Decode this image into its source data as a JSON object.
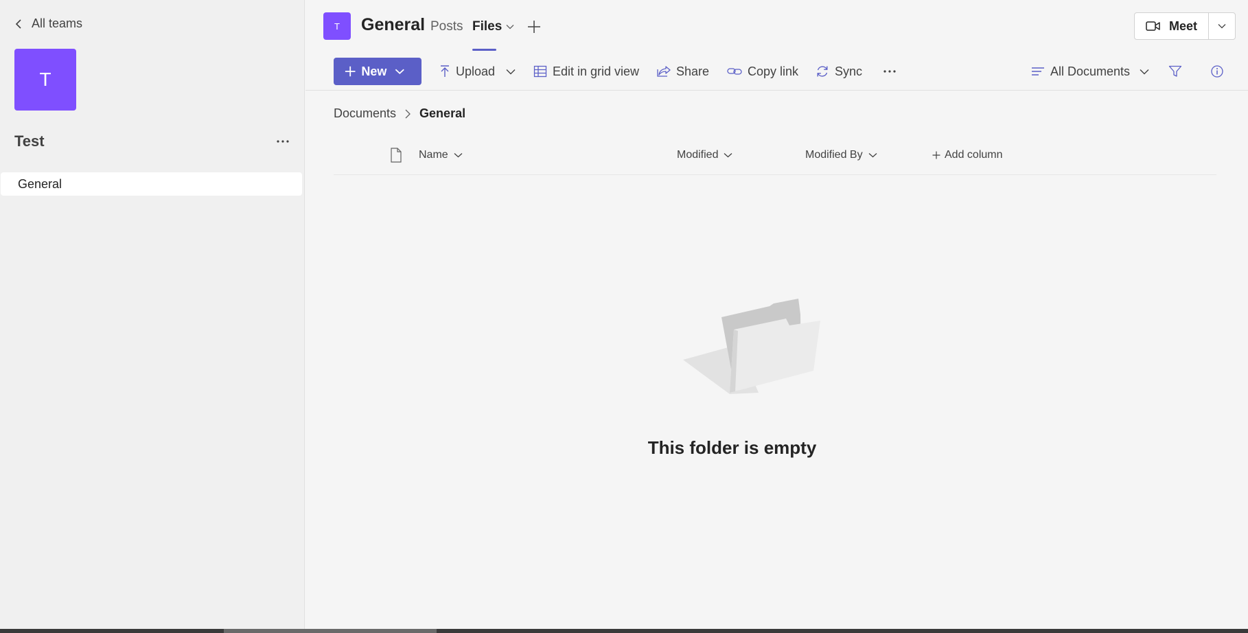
{
  "sidebar": {
    "back_label": "All teams",
    "team_avatar_letter": "T",
    "team_name": "Test",
    "channels": [
      {
        "label": "General"
      }
    ]
  },
  "header": {
    "channel_avatar_letter": "T",
    "channel_title": "General",
    "tabs": [
      {
        "label": "Posts",
        "active": false
      },
      {
        "label": "Files",
        "active": true
      }
    ],
    "meet_label": "Meet"
  },
  "toolbar": {
    "new_label": "New",
    "upload_label": "Upload",
    "grid_label": "Edit in grid view",
    "share_label": "Share",
    "copy_link_label": "Copy link",
    "sync_label": "Sync",
    "view_label": "All Documents"
  },
  "breadcrumb": {
    "root": "Documents",
    "current": "General"
  },
  "columns": {
    "name": "Name",
    "modified": "Modified",
    "modified_by": "Modified By",
    "add_column": "Add column"
  },
  "empty_state": {
    "message": "This folder is empty"
  },
  "colors": {
    "accent": "#5b5fc7",
    "avatar": "#7f4fff",
    "sidebar_bg": "#f0f0f0",
    "main_bg": "#f5f5f5"
  }
}
